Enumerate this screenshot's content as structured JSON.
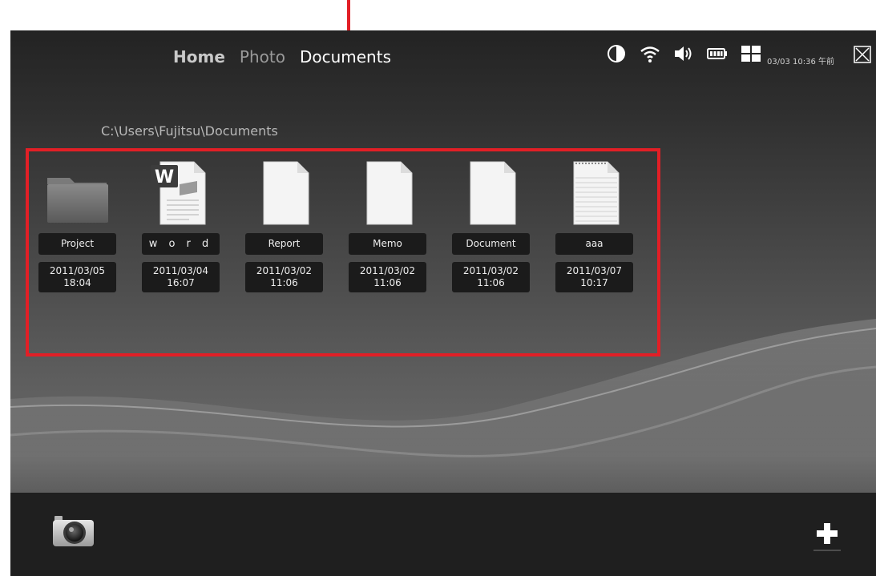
{
  "nav": {
    "tabs": [
      {
        "label": "Home"
      },
      {
        "label": "Photo"
      },
      {
        "label": "Documents"
      }
    ]
  },
  "status": {
    "icons": [
      "brightness-icon",
      "wifi-icon",
      "volume-icon",
      "battery-icon",
      "grid-icon"
    ],
    "datetime": "03/03 10:36 午前"
  },
  "breadcrumb": {
    "path": "C:\\Users\\Fujitsu\\Documents"
  },
  "files": [
    {
      "name": "Project",
      "date": "2011/03/05",
      "time": "18:04",
      "type": "folder"
    },
    {
      "name": "w o r d",
      "date": "2011/03/04",
      "time": "16:07",
      "type": "word"
    },
    {
      "name": "Report",
      "date": "2011/03/02",
      "time": "11:06",
      "type": "blank"
    },
    {
      "name": "Memo",
      "date": "2011/03/02",
      "time": "11:06",
      "type": "blank"
    },
    {
      "name": "Document",
      "date": "2011/03/02",
      "time": "11:06",
      "type": "blank"
    },
    {
      "name": "aaa",
      "date": "2011/03/07",
      "time": "10:17",
      "type": "text"
    }
  ],
  "colors": {
    "highlight": "#e21f26",
    "background": "#474747",
    "label_bg": "#1b1b1b"
  }
}
